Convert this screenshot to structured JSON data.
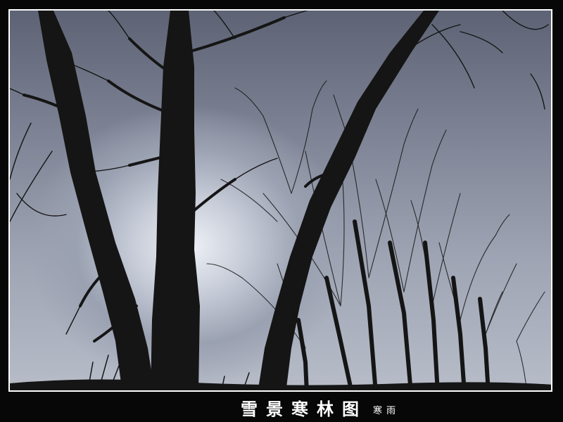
{
  "caption": {
    "title": "雪景寒林图",
    "author": "寒雨"
  },
  "colors": {
    "frame": "#ffffff",
    "background": "#070707",
    "sky_light": "#eef1f6",
    "sky_dark": "#5d6374",
    "tree": "#141414"
  }
}
